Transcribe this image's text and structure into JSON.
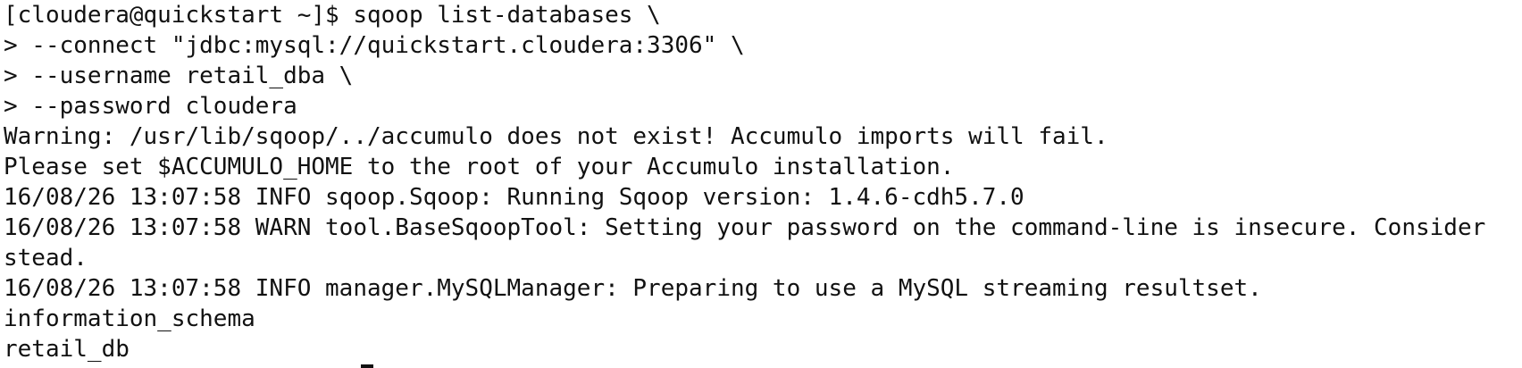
{
  "terminal": {
    "lines": [
      "[cloudera@quickstart ~]$ sqoop list-databases \\",
      "> --connect \"jdbc:mysql://quickstart.cloudera:3306\" \\",
      "> --username retail_dba \\",
      "> --password cloudera",
      "Warning: /usr/lib/sqoop/../accumulo does not exist! Accumulo imports will fail.",
      "Please set $ACCUMULO_HOME to the root of your Accumulo installation.",
      "16/08/26 13:07:58 INFO sqoop.Sqoop: Running Sqoop version: 1.4.6-cdh5.7.0",
      "16/08/26 13:07:58 WARN tool.BaseSqoopTool: Setting your password on the command-line is insecure. Consider",
      "stead.",
      "16/08/26 13:07:58 INFO manager.MySQLManager: Preparing to use a MySQL streaming resultset.",
      "information_schema",
      "retail_db"
    ]
  }
}
